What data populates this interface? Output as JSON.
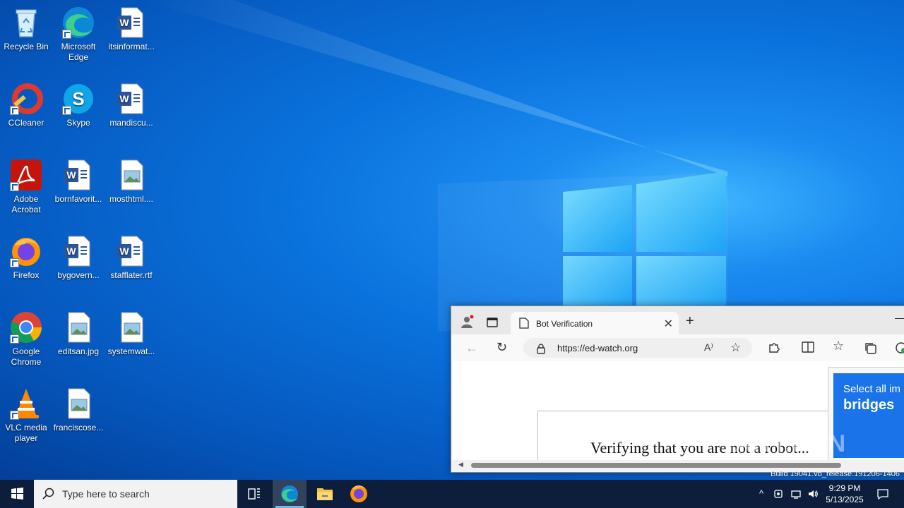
{
  "desktop": {
    "icons": [
      {
        "label": "Recycle Bin"
      },
      {
        "label": "Microsoft Edge"
      },
      {
        "label": "itsinformat..."
      },
      {
        "label": "CCleaner"
      },
      {
        "label": "Skype"
      },
      {
        "label": "mandiscu..."
      },
      {
        "label": "Adobe Acrobat"
      },
      {
        "label": "bornfavorit..."
      },
      {
        "label": "mosthtml...."
      },
      {
        "label": "Firefox"
      },
      {
        "label": "bygovern..."
      },
      {
        "label": "stafflater.rtf"
      },
      {
        "label": "Google Chrome"
      },
      {
        "label": "editsan.jpg"
      },
      {
        "label": "systemwat..."
      },
      {
        "label": "VLC media player"
      },
      {
        "label": "franciscose..."
      }
    ],
    "build_text": "Build 19041.vb_release.191206-1406",
    "watermark": "ANY.RUN"
  },
  "browser": {
    "tab_title": "Bot Verification",
    "url": "https://ed-watch.org",
    "page": {
      "verify_text": "Verifying that you are not a robot...",
      "captcha_subtitle": "Select all im",
      "captcha_title": "bridges"
    }
  },
  "taskbar": {
    "search_placeholder": "Type here to search",
    "time": "9:29 PM",
    "date": "5/13/2025"
  },
  "colors": {
    "taskbar": "#0c1e3c",
    "accent": "#1a73e8",
    "desktop": "#0a72dc"
  }
}
